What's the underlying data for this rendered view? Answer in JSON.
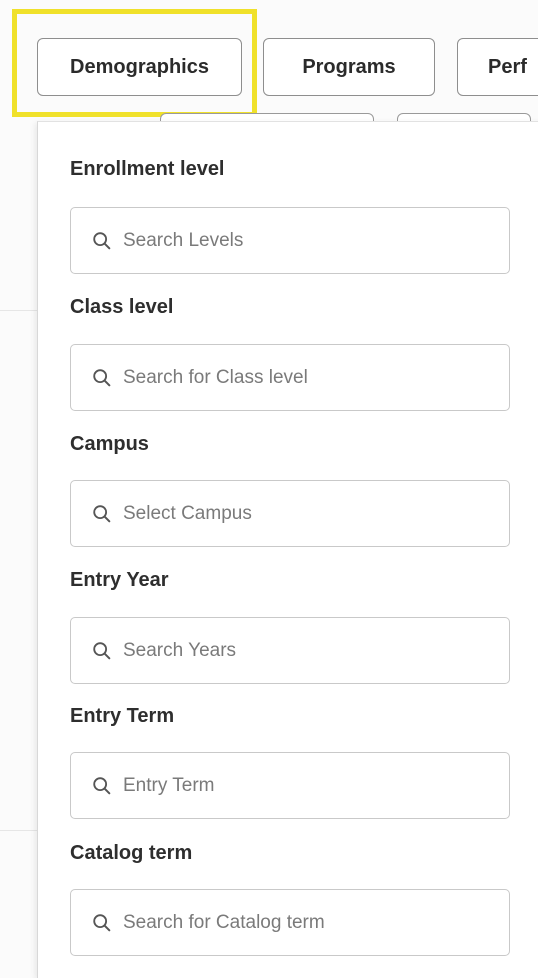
{
  "tabs": [
    {
      "label": "Demographics",
      "selected": true
    },
    {
      "label": "Programs"
    },
    {
      "label": "Perf"
    }
  ],
  "highlight_color": "#f0e12a",
  "filters": [
    {
      "label": "Enrollment level",
      "placeholder": "Search Levels",
      "icon": "search-icon"
    },
    {
      "label": "Class level",
      "placeholder": "Search for Class level",
      "icon": "search-icon"
    },
    {
      "label": "Campus",
      "placeholder": "Select Campus",
      "icon": "search-icon"
    },
    {
      "label": "Entry Year",
      "placeholder": "Search Years",
      "icon": "search-icon"
    },
    {
      "label": "Entry Term",
      "placeholder": "Entry Term",
      "icon": "search-icon"
    },
    {
      "label": "Catalog term",
      "placeholder": "Search for Catalog term",
      "icon": "search-icon"
    }
  ]
}
